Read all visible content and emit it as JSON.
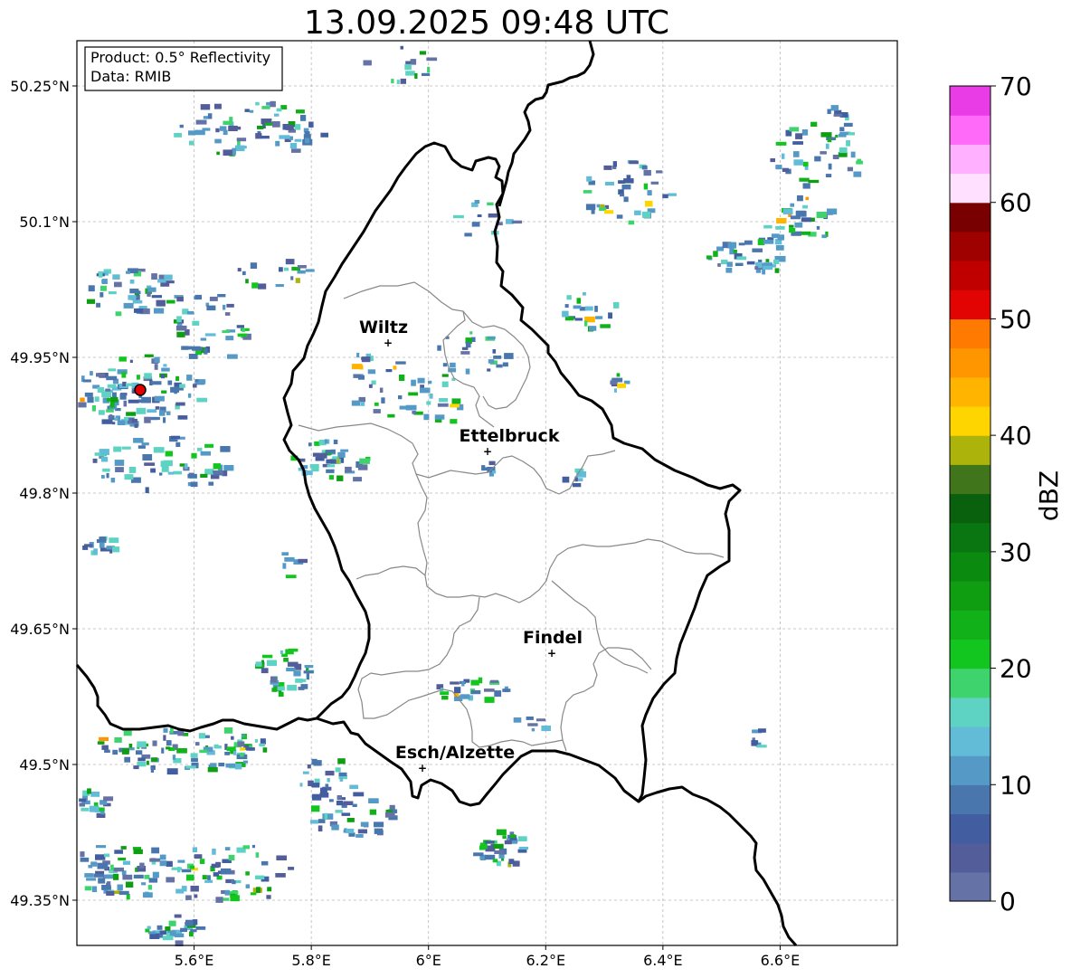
{
  "title": "13.09.2025 09:48 UTC",
  "info_box": {
    "product": "Product: 0.5° Reflectivity",
    "data_source": "Data: RMIB"
  },
  "map": {
    "lon_range": [
      5.4,
      6.8
    ],
    "lat_range": [
      49.3,
      50.3
    ],
    "lat_ticks": [
      {
        "value": 50.25,
        "label": "50.25°N"
      },
      {
        "value": 50.1,
        "label": "50.1°N"
      },
      {
        "value": 49.95,
        "label": "49.95°N"
      },
      {
        "value": 49.8,
        "label": "49.8°N"
      },
      {
        "value": 49.65,
        "label": "49.65°N"
      },
      {
        "value": 49.5,
        "label": "49.5°N"
      },
      {
        "value": 49.35,
        "label": "49.35°N"
      }
    ],
    "lon_ticks": [
      {
        "value": 5.6,
        "label": "5.6°E"
      },
      {
        "value": 5.8,
        "label": "5.8°E"
      },
      {
        "value": 6.0,
        "label": "6°E"
      },
      {
        "value": 6.2,
        "label": "6.2°E"
      },
      {
        "value": 6.4,
        "label": "6.4°E"
      },
      {
        "value": 6.6,
        "label": "6.6°E"
      }
    ],
    "grid": true,
    "cities": [
      {
        "name": "Wiltz",
        "lon": 5.93,
        "lat": 49.97
      },
      {
        "name": "Ettelbruck",
        "lon": 6.1,
        "lat": 49.85
      },
      {
        "name": "Findel",
        "lon": 6.21,
        "lat": 49.627
      },
      {
        "name": "Esch/Alzette",
        "lon": 5.99,
        "lat": 49.5
      }
    ],
    "radar_site": {
      "lon": 5.505,
      "lat": 49.915
    }
  },
  "colorbar": {
    "label": "dBZ",
    "min": 0,
    "max": 70,
    "step": 2.5,
    "tick_labels": [
      "0",
      "10",
      "20",
      "30",
      "40",
      "50",
      "60",
      "70"
    ],
    "colors": [
      "#6572a6",
      "#525d9a",
      "#425ea0",
      "#4a76ae",
      "#5599c6",
      "#62bcd8",
      "#5fd3c3",
      "#3fd36d",
      "#13c61f",
      "#11b11a",
      "#0f9e12",
      "#0b8a10",
      "#0a7612",
      "#09610d",
      "#41751b",
      "#acb30a",
      "#ffd500",
      "#ffb400",
      "#ff9600",
      "#ff7a00",
      "#e20303",
      "#c00000",
      "#9f0000",
      "#790000",
      "#ffe1ff",
      "#ffb1ff",
      "#ff6af9",
      "#e93ce6"
    ]
  }
}
